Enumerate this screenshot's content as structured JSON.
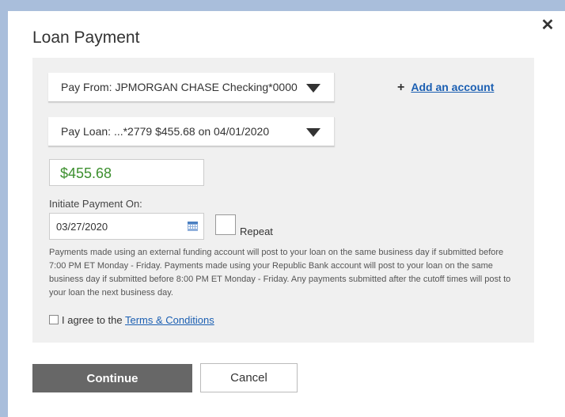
{
  "dialog": {
    "title": "Loan Payment",
    "close_icon": "close-icon"
  },
  "pay_from": {
    "label": "Pay From: JPMORGAN CHASE Checking*0000"
  },
  "pay_loan": {
    "label": "Pay Loan: ...*2779 $455.68 on 04/01/2020"
  },
  "add_account": {
    "plus": "+",
    "link_text": "Add an account"
  },
  "amount": {
    "value": "$455.68",
    "color": "#3c8f2e"
  },
  "initiate": {
    "label": "Initiate Payment On:",
    "date_value": "03/27/2020",
    "calendar_icon": "calendar-icon"
  },
  "repeat": {
    "label": "Repeat"
  },
  "disclaimer": "Payments made using an external funding account will post to your loan on the same business day if submitted before 7:00 PM ET Monday - Friday. Payments made using your Republic Bank account will post to your loan on the same business day if submitted before 8:00 PM ET Monday - Friday. Any payments submitted after the cutoff times will post to your loan the next business day.",
  "agree": {
    "prefix": "I agree to the ",
    "link_text": "Terms & Conditions"
  },
  "buttons": {
    "continue": "Continue",
    "cancel": "Cancel"
  }
}
